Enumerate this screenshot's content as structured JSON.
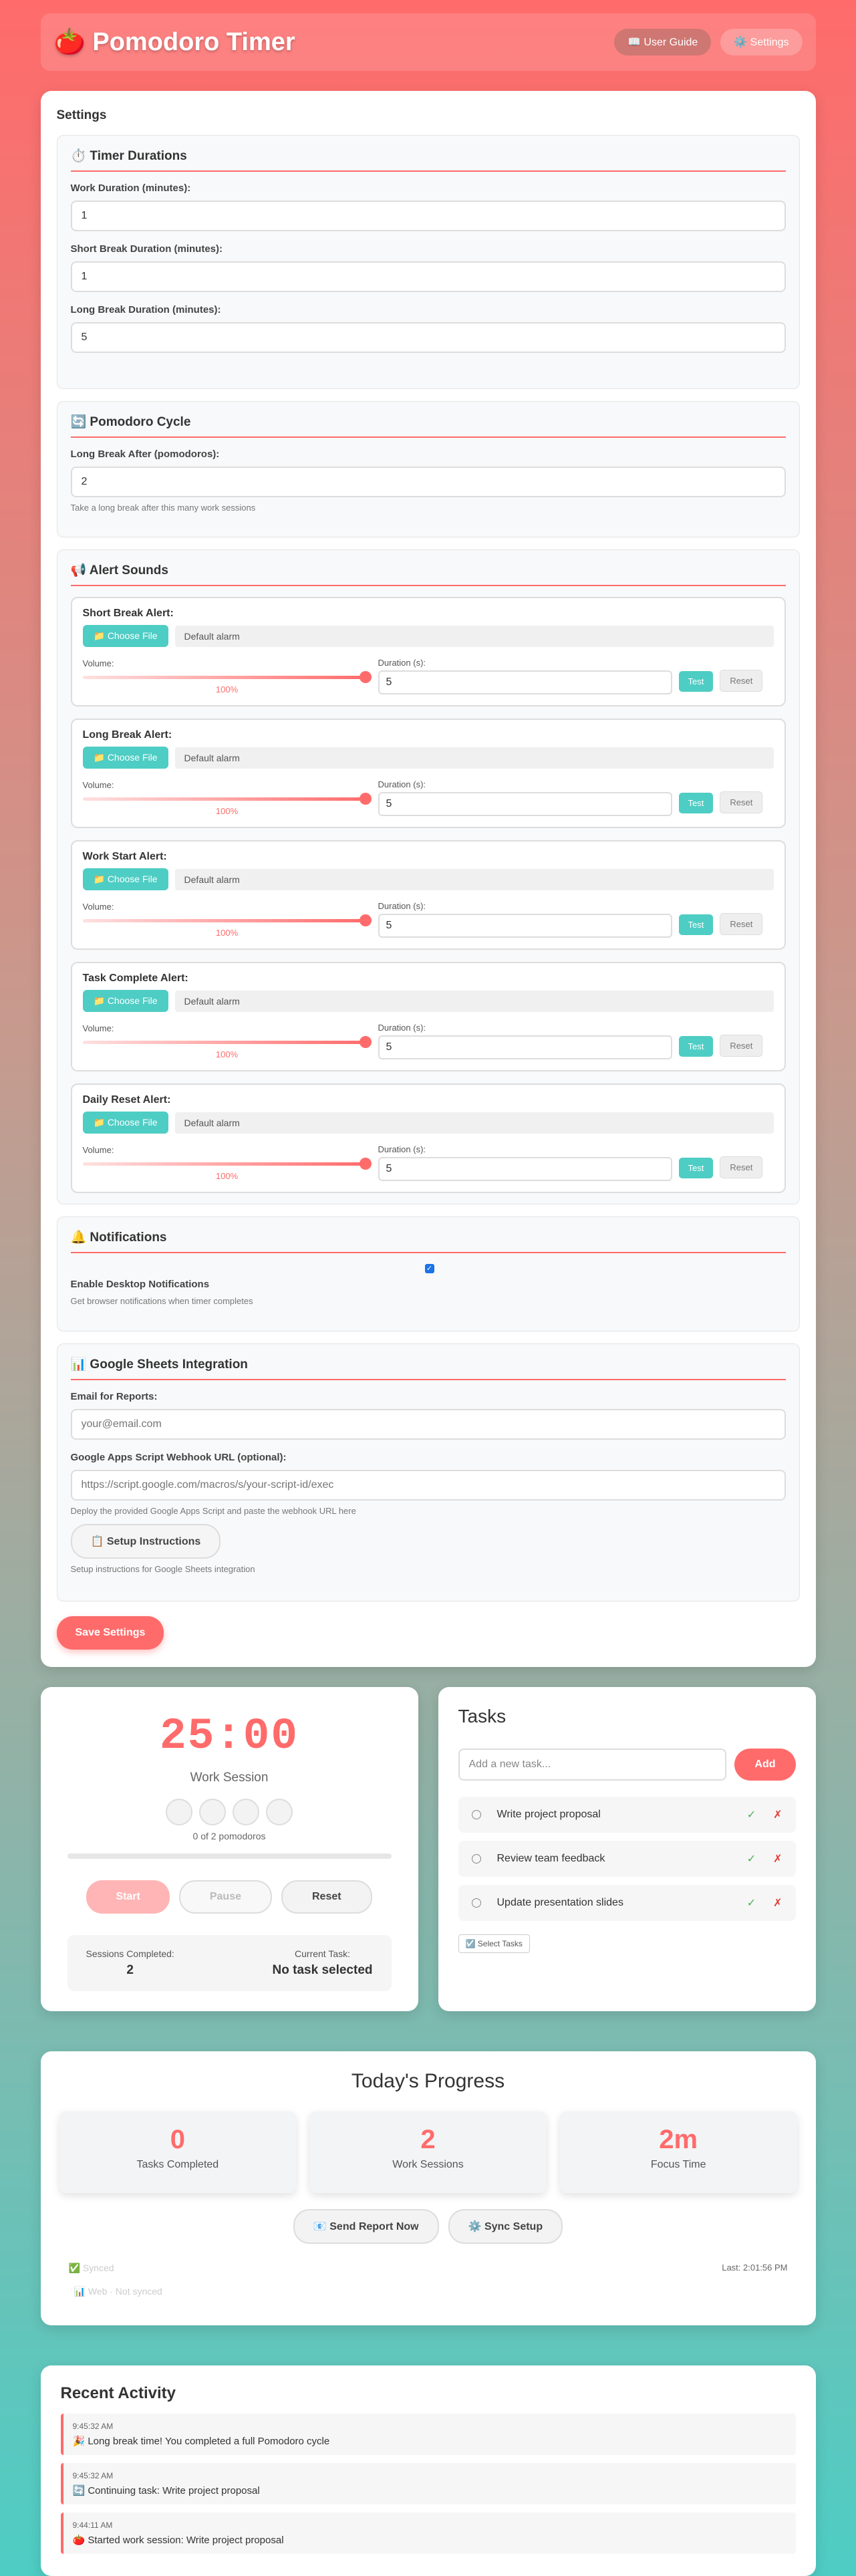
{
  "header": {
    "title": "🍅 Pomodoro Timer",
    "guide_label": "📖 User Guide",
    "settings_label": "⚙️ Settings"
  },
  "settings": {
    "heading": "Settings",
    "timer": {
      "title": "⏱️ Timer Durations",
      "work_label": "Work Duration (minutes):",
      "work_value": "1",
      "short_label": "Short Break Duration (minutes):",
      "short_value": "1",
      "long_label": "Long Break Duration (minutes):",
      "long_value": "5"
    },
    "cycle": {
      "title": "🔄 Pomodoro Cycle",
      "label": "Long Break After (pomodoros):",
      "value": "2",
      "hint": "Take a long break after this many work sessions"
    },
    "sounds": {
      "title": "📢 Alert Sounds",
      "choose_label": "📁 Choose File",
      "volume_label": "Volume:",
      "duration_label": "Duration (s):",
      "test_label": "Test",
      "reset_label": "Reset",
      "alerts": [
        {
          "title": "Short Break Alert:",
          "file": "Default alarm",
          "volume": "100%",
          "duration": "5"
        },
        {
          "title": "Long Break Alert:",
          "file": "Default alarm",
          "volume": "100%",
          "duration": "5"
        },
        {
          "title": "Work Start Alert:",
          "file": "Default alarm",
          "volume": "100%",
          "duration": "5"
        },
        {
          "title": "Task Complete Alert:",
          "file": "Default alarm",
          "volume": "100%",
          "duration": "5"
        },
        {
          "title": "Daily Reset Alert:",
          "file": "Default alarm",
          "volume": "100%",
          "duration": "5"
        }
      ]
    },
    "notifications": {
      "title": "🔔 Notifications",
      "label": "Enable Desktop Notifications",
      "checked": true,
      "hint": "Get browser notifications when timer completes"
    },
    "sheets": {
      "title": "📊 Google Sheets Integration",
      "email_label": "Email for Reports:",
      "email_placeholder": "your@email.com",
      "webhook_label": "Google Apps Script Webhook URL (optional):",
      "webhook_placeholder": "https://script.google.com/macros/s/your-script-id/exec",
      "webhook_hint": "Deploy the provided Google Apps Script and paste the webhook URL here",
      "setup_label": "📋 Setup Instructions",
      "setup_hint": "Setup instructions for Google Sheets integration"
    },
    "save_label": "Save Settings"
  },
  "timer": {
    "time": "25:00",
    "session": "Work Session",
    "pomodoro_count": "0 of 2 pomodoros",
    "start": "Start",
    "pause": "Pause",
    "reset": "Reset",
    "sessions_label": "Sessions Completed:",
    "sessions_value": "2",
    "current_label": "Current Task:",
    "current_value": "No task selected"
  },
  "tasks": {
    "title": "Tasks",
    "placeholder": "Add a new task...",
    "add_label": "Add",
    "items": [
      {
        "name": "Write project proposal"
      },
      {
        "name": "Review team feedback"
      },
      {
        "name": "Update presentation slides"
      }
    ],
    "complete_glyph": "✓",
    "delete_glyph": "✗",
    "select_label": "☑️ Select Tasks"
  },
  "progress": {
    "title": "Today's Progress",
    "tasks_value": "0",
    "tasks_label": "Tasks Completed",
    "sessions_value": "2",
    "sessions_label": "Work Sessions",
    "focus_value": "2m",
    "focus_label": "Focus Time",
    "report_label": "📧 Send Report Now",
    "sync_label": "⚙️ Sync Setup",
    "synced": "✅ Synced",
    "last": "Last: 2:01:56 PM",
    "sheets_status": "📊 Web · Not synced"
  },
  "recent": {
    "title": "Recent Activity",
    "items": [
      {
        "time": "9:45:32 AM",
        "message": "🎉 Long break time! You completed a full Pomodoro cycle"
      },
      {
        "time": "9:45:32 AM",
        "message": "🔄 Continuing task: Write project proposal"
      },
      {
        "time": "9:44:11 AM",
        "message": "🍅 Started work session: Write project proposal"
      }
    ]
  },
  "colors": {
    "accent": "#ff6b6b",
    "teal": "#4ecdc4"
  }
}
